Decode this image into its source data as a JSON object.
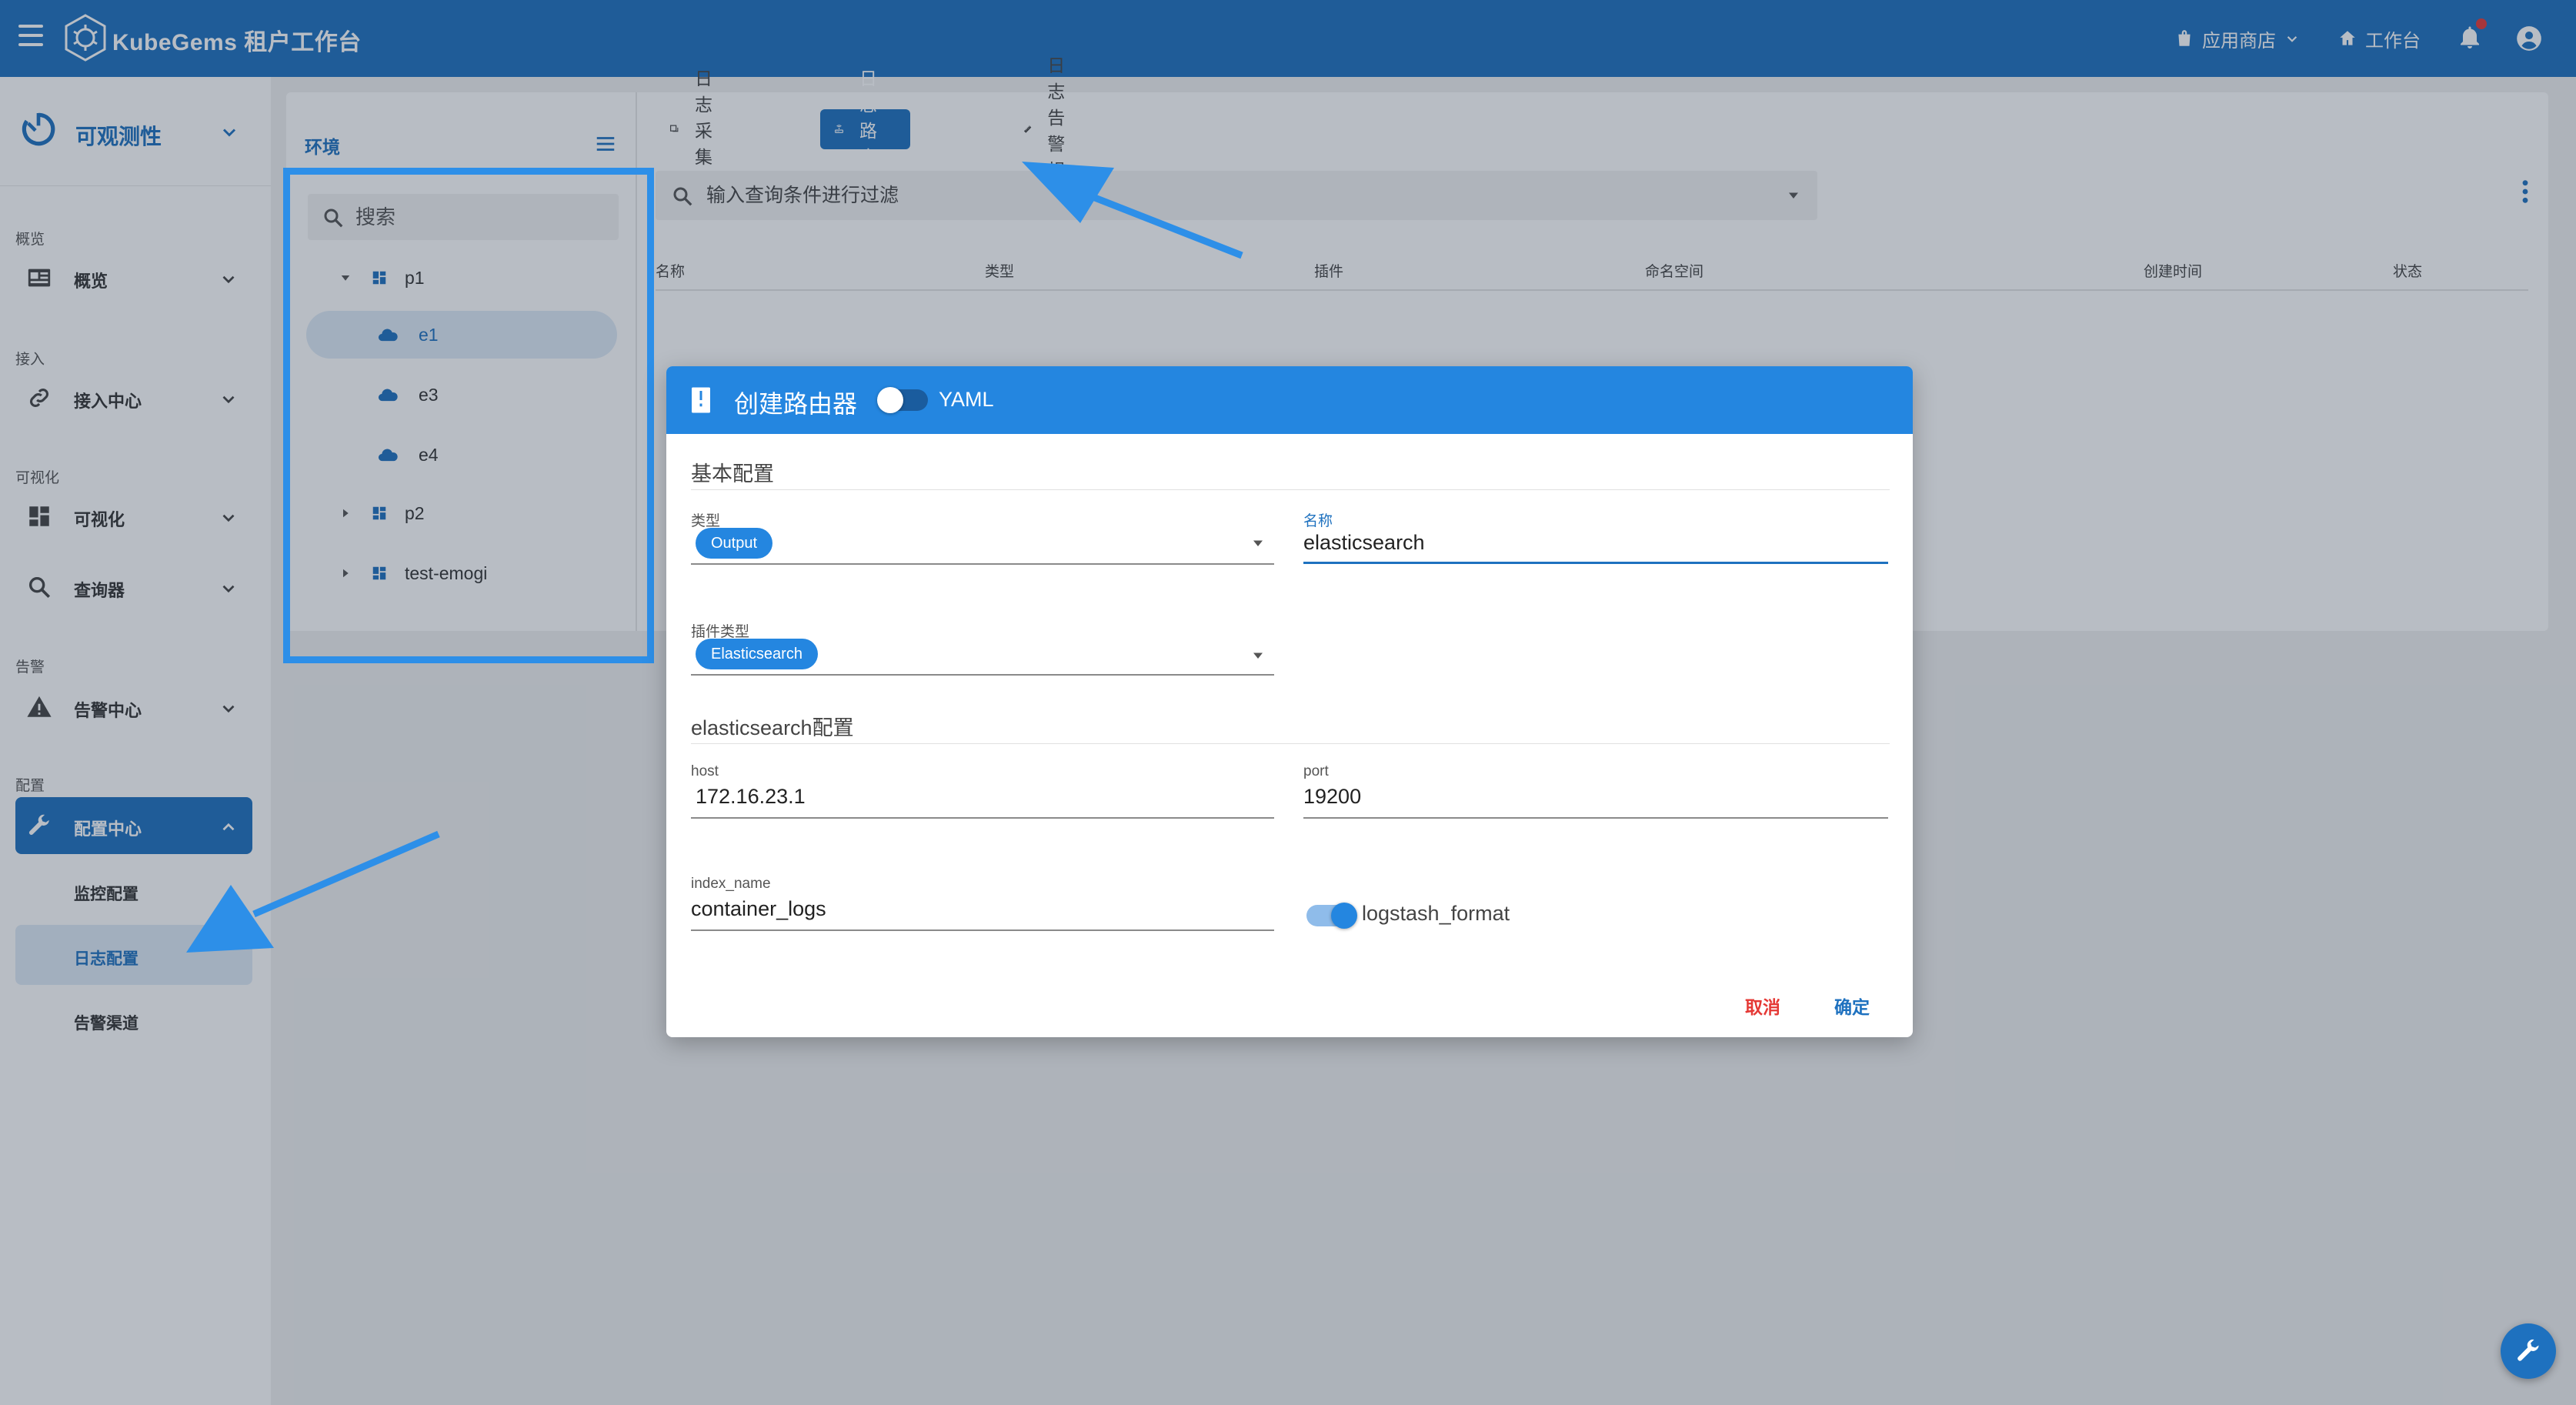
{
  "topbar": {
    "brand": "KubeGems 租户工作台",
    "app_store": "应用商店",
    "workspace": "工作台"
  },
  "sidebar": {
    "module": "可观测性",
    "groups": {
      "overview": "概览",
      "access": "接入",
      "visual": "可视化",
      "alert": "告警",
      "config": "配置"
    },
    "items": {
      "overview": "概览",
      "access_center": "接入中心",
      "visualize": "可视化",
      "query": "查询器",
      "alert_center": "告警中心",
      "config_center": "配置中心"
    },
    "sub_items": {
      "monitor_config": "监控配置",
      "log_config": "日志配置",
      "alert_channel": "告警渠道"
    }
  },
  "env_panel": {
    "title": "环境",
    "search_placeholder": "搜索",
    "tree": {
      "p1": "p1",
      "e1": "e1",
      "e3": "e3",
      "e4": "e4",
      "p2": "p2",
      "test": "test-emogi"
    }
  },
  "tabs": {
    "collector": "日志采集器",
    "router": "日志路由器",
    "alert_rules": "日志告警规则"
  },
  "filter": {
    "placeholder": "输入查询条件进行过滤"
  },
  "table": {
    "headers": {
      "name": "名称",
      "type": "类型",
      "plugin": "插件",
      "namespace": "命名空间",
      "created": "创建时间",
      "status": "状态"
    }
  },
  "dialog": {
    "title": "创建路由器",
    "yaml_label": "YAML",
    "basic_section": "基本配置",
    "type_label": "类型",
    "type_value": "Output",
    "name_label": "名称",
    "name_value": "elasticsearch",
    "plugin_type_label": "插件类型",
    "plugin_type_value": "Elasticsearch",
    "es_section": "elasticsearch配置",
    "host_label": "host",
    "host_value": "172.16.23.1",
    "port_label": "port",
    "port_value": "19200",
    "index_label": "index_name",
    "index_value": "container_logs",
    "logstash_label": "logstash_format",
    "cancel": "取消",
    "confirm": "确定"
  },
  "colors": {
    "primary": "#1e71bf",
    "dialog_header": "#2486e0",
    "cancel": "#e53935",
    "highlight": "#2d8fe8"
  }
}
